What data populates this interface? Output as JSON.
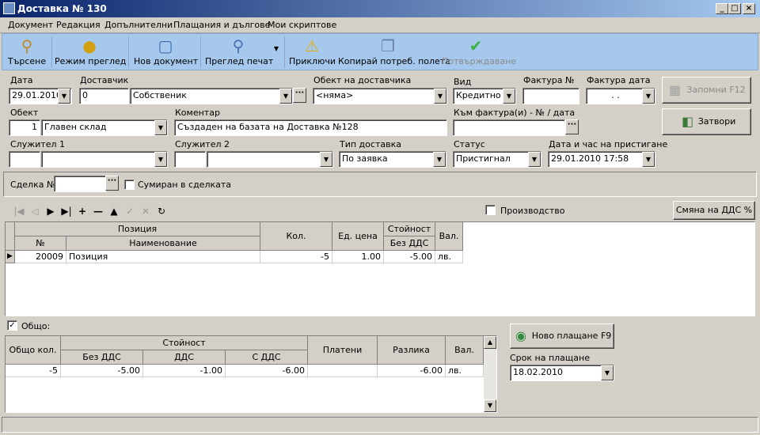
{
  "window": {
    "title": "Доставка № 130"
  },
  "menu": [
    "Документ",
    "Редакция",
    "Допълнителни",
    "Плащания и дългове",
    "Мои скриптове"
  ],
  "toolbar": {
    "search": "Търсене",
    "view_mode": "Режим преглед",
    "new_doc": "Нов документ",
    "print_preview": "Преглед печат",
    "finish": "Приключи",
    "copy_fields": "Копирай потреб. полета",
    "confirm": "Потвърждаване"
  },
  "form": {
    "date_label": "Дата",
    "date_value": "29.01.2010",
    "supplier_label": "Доставчик",
    "supplier_code": "0",
    "supplier_name": "Собственик",
    "supplier_object_label": "Обект на доставчика",
    "supplier_object_value": "<няма>",
    "type_label": "Вид",
    "type_value": "Кредитно и",
    "invoice_no_label": "Фактура №",
    "invoice_no_value": "",
    "invoice_date_label": "Фактура дата",
    "invoice_date_value": ". .",
    "object_label": "Обект",
    "object_code": "1",
    "object_name": "Главен склад",
    "comment_label": "Коментар",
    "comment_value": "Създаден на базата на Доставка №128",
    "to_invoice_label": "Към фактура(и) - № / дата",
    "to_invoice_value": "",
    "employee1_label": "Служител 1",
    "employee2_label": "Служител 2",
    "delivery_type_label": "Тип доставка",
    "delivery_type_value": "По заявка",
    "status_label": "Статус",
    "status_value": "Пристигнал",
    "arrival_label": "Дата и час на пристигане",
    "arrival_value": "29.01.2010 17:58",
    "save_button": "Запомни  F12",
    "close_button": "Затвори"
  },
  "deal": {
    "label": "Сделка №",
    "value": "",
    "summed_label": "Сумиран в сделката",
    "summed_checked": false
  },
  "items_bar": {
    "production_label": "Производство",
    "production_checked": false,
    "vat_change_button": "Смяна на ДДС %"
  },
  "items_grid": {
    "headers": {
      "position": "Позиция",
      "no": "№",
      "name": "Наименование",
      "qty": "Кол.",
      "unit_price": "Ед. цена",
      "value": "Стойност",
      "value_no_vat": "Без ДДС",
      "currency": "Вал."
    },
    "rows": [
      {
        "no": "20009",
        "name": "Позиция",
        "qty": "-5",
        "unit_price": "1.00",
        "value": "-5.00",
        "currency": "лв."
      }
    ]
  },
  "totals": {
    "checkbox_label": "Общо:",
    "checked": true,
    "headers": {
      "total_qty": "Общо кол.",
      "value": "Стойност",
      "no_vat": "Без ДДС",
      "vat": "ДДС",
      "with_vat": "С ДДС",
      "paid": "Платени",
      "diff": "Разлика",
      "currency": "Вал."
    },
    "row": {
      "total_qty": "-5",
      "no_vat": "-5.00",
      "vat": "-1.00",
      "with_vat": "-6.00",
      "paid": "",
      "diff": "-6.00",
      "currency": "лв."
    }
  },
  "payment": {
    "new_payment_button": "Ново плащане  F9",
    "due_label": "Срок на плащане",
    "due_value": "18.02.2010"
  }
}
